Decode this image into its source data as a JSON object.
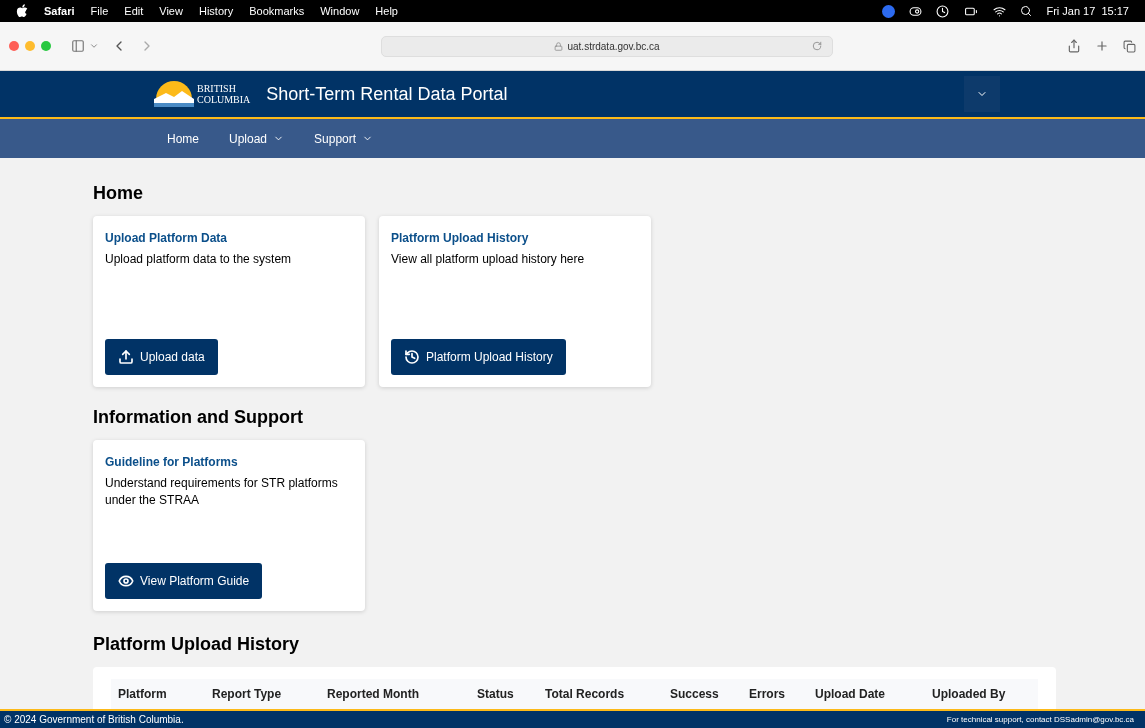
{
  "menubar": {
    "app": "Safari",
    "items": [
      "File",
      "Edit",
      "View",
      "History",
      "Bookmarks",
      "Window",
      "Help"
    ],
    "clock": "Fri Jan 17  15:17"
  },
  "browser": {
    "url": "uat.strdata.gov.bc.ca"
  },
  "header": {
    "logo_line1": "BRITISH",
    "logo_line2": "COLUMBIA",
    "title": "Short-Term Rental Data Portal"
  },
  "nav": [
    {
      "label": "Home",
      "dropdown": false
    },
    {
      "label": "Upload",
      "dropdown": true
    },
    {
      "label": "Support",
      "dropdown": true
    }
  ],
  "sections": [
    {
      "heading": "Home",
      "cards": [
        {
          "title": "Upload Platform Data",
          "text": "Upload platform data to the system",
          "button": "Upload data",
          "kind": "upload"
        },
        {
          "title": "Platform Upload History",
          "text": "View all platform upload history here",
          "button": "Platform Upload History",
          "kind": "history"
        }
      ]
    },
    {
      "heading": "Information and Support",
      "cards": [
        {
          "title": "Guideline for Platforms",
          "text": "Understand requirements for STR platforms under the STRAA",
          "button": "View Platform Guide",
          "kind": "guide"
        }
      ]
    }
  ],
  "history": {
    "heading": "Platform Upload History",
    "columns": [
      "Platform",
      "Report Type",
      "Reported Month",
      "Status",
      "Total Records",
      "Success",
      "Errors",
      "Upload Date",
      "Uploaded By"
    ]
  },
  "footer": {
    "left": "© 2024 Government of British Columbia.",
    "right": "For technical support, contact DSSadmin@gov.bc.ca"
  }
}
